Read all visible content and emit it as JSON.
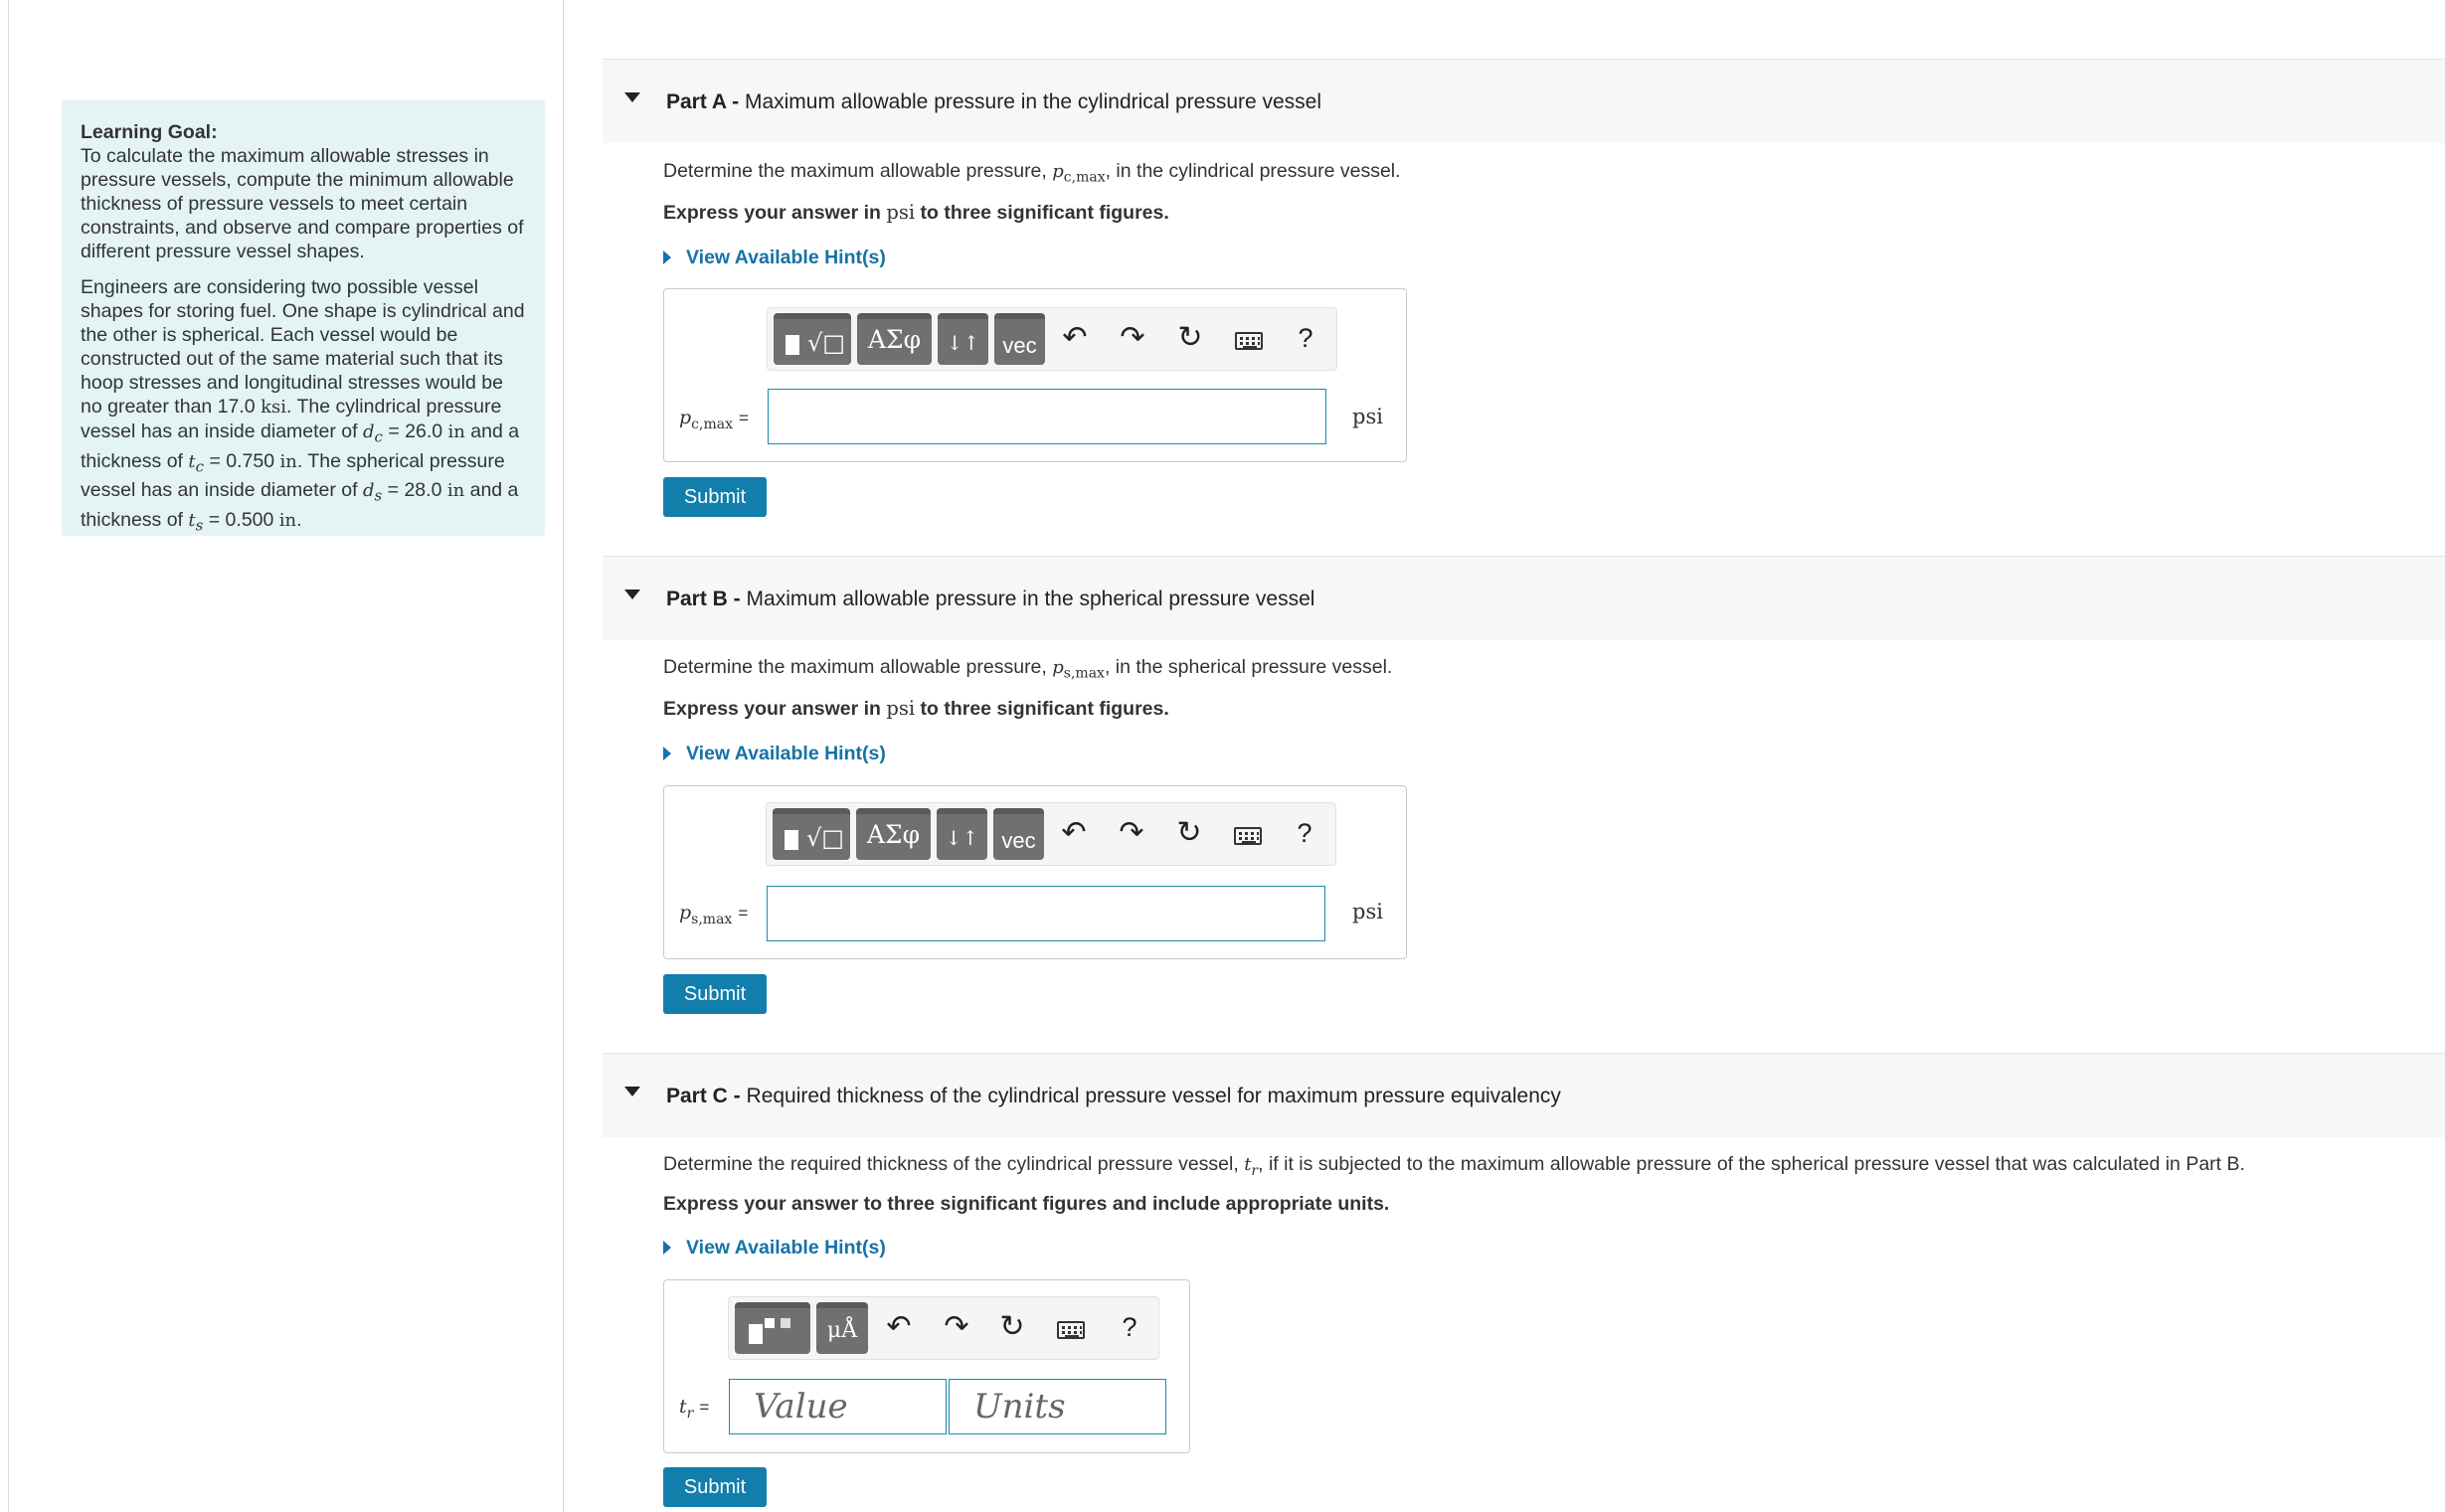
{
  "goal": {
    "title": "Learning Goal:",
    "text1": "To calculate the maximum allowable stresses in pressure vessels, compute the minimum allowable thickness of pressure vessels to meet certain constraints, and observe and compare properties of different pressure vessel shapes.",
    "p2": {
      "a": "Engineers are considering two possible vessel shapes for storing fuel. One shape is cylindrical and the other is spherical. Each vessel would be constructed out of the same material such that its hoop stresses and longitudinal stresses would be no greater than 17.0 ",
      "ksi": "ksi",
      "b": ". The cylindrical pressure vessel has an inside diameter of ",
      "dc_sym": "d",
      "dc_sub": "c",
      "dc_val": " = 26.0 ",
      "in1": "in",
      "c": " and a thickness of ",
      "tc_sym": "t",
      "tc_sub": "c",
      "tc_val": " = 0.750 ",
      "in2": "in",
      "d": ". The spherical pressure vessel has an inside diameter of ",
      "ds_sym": "d",
      "ds_sub": "s",
      "ds_val": " = 28.0 ",
      "in3": "in",
      "e": " and a thickness of ",
      "ts_sym": "t",
      "ts_sub": "s",
      "ts_val": " = 0.500 ",
      "in4": "in",
      "f": "."
    }
  },
  "parts": {
    "a": {
      "label": "Part A -",
      "title": " Maximum allowable pressure in the cylindrical pressure vessel",
      "q_before": "Determine the maximum allowable pressure, ",
      "sym": "p",
      "sub": "c,max",
      "q_after": ", in the cylindrical pressure vessel.",
      "instr_a": "Express your answer in ",
      "instr_unit": "psi",
      "instr_b": " to three significant figures.",
      "hint": "View Available Hint(s)",
      "label_eq": "=",
      "unit": "psi",
      "submit": "Submit"
    },
    "b": {
      "label": "Part B -",
      "title": " Maximum allowable pressure in the spherical pressure vessel",
      "q_before": "Determine the maximum allowable pressure, ",
      "sym": "p",
      "sub": "s,max",
      "q_after": ", in the spherical pressure vessel.",
      "instr_a": "Express your answer in ",
      "instr_unit": "psi",
      "instr_b": " to three significant figures.",
      "hint": "View Available Hint(s)",
      "label_eq": "=",
      "unit": "psi",
      "submit": "Submit"
    },
    "c": {
      "label": "Part C -",
      "title": " Required thickness of the cylindrical pressure vessel for maximum pressure equivalency",
      "q_before": "Determine the required thickness of the cylindrical pressure vessel, ",
      "sym": "t",
      "sub": "r",
      "q_after": ", if it is subjected to the maximum allowable pressure of the spherical pressure vessel that was calculated in Part B.",
      "instr": "Express your answer to three significant figures and include appropriate units.",
      "hint": "View Available Hint(s)",
      "label_eq": "=",
      "value_placeholder": "Value",
      "units_placeholder": "Units",
      "submit": "Submit"
    }
  },
  "toolbar": {
    "greek": "ΑΣφ",
    "arrows": "↓↑",
    "vec": "vec",
    "undo": "↶",
    "redo": "↷",
    "reset": "↻",
    "help": "?",
    "units": "μÅ"
  }
}
